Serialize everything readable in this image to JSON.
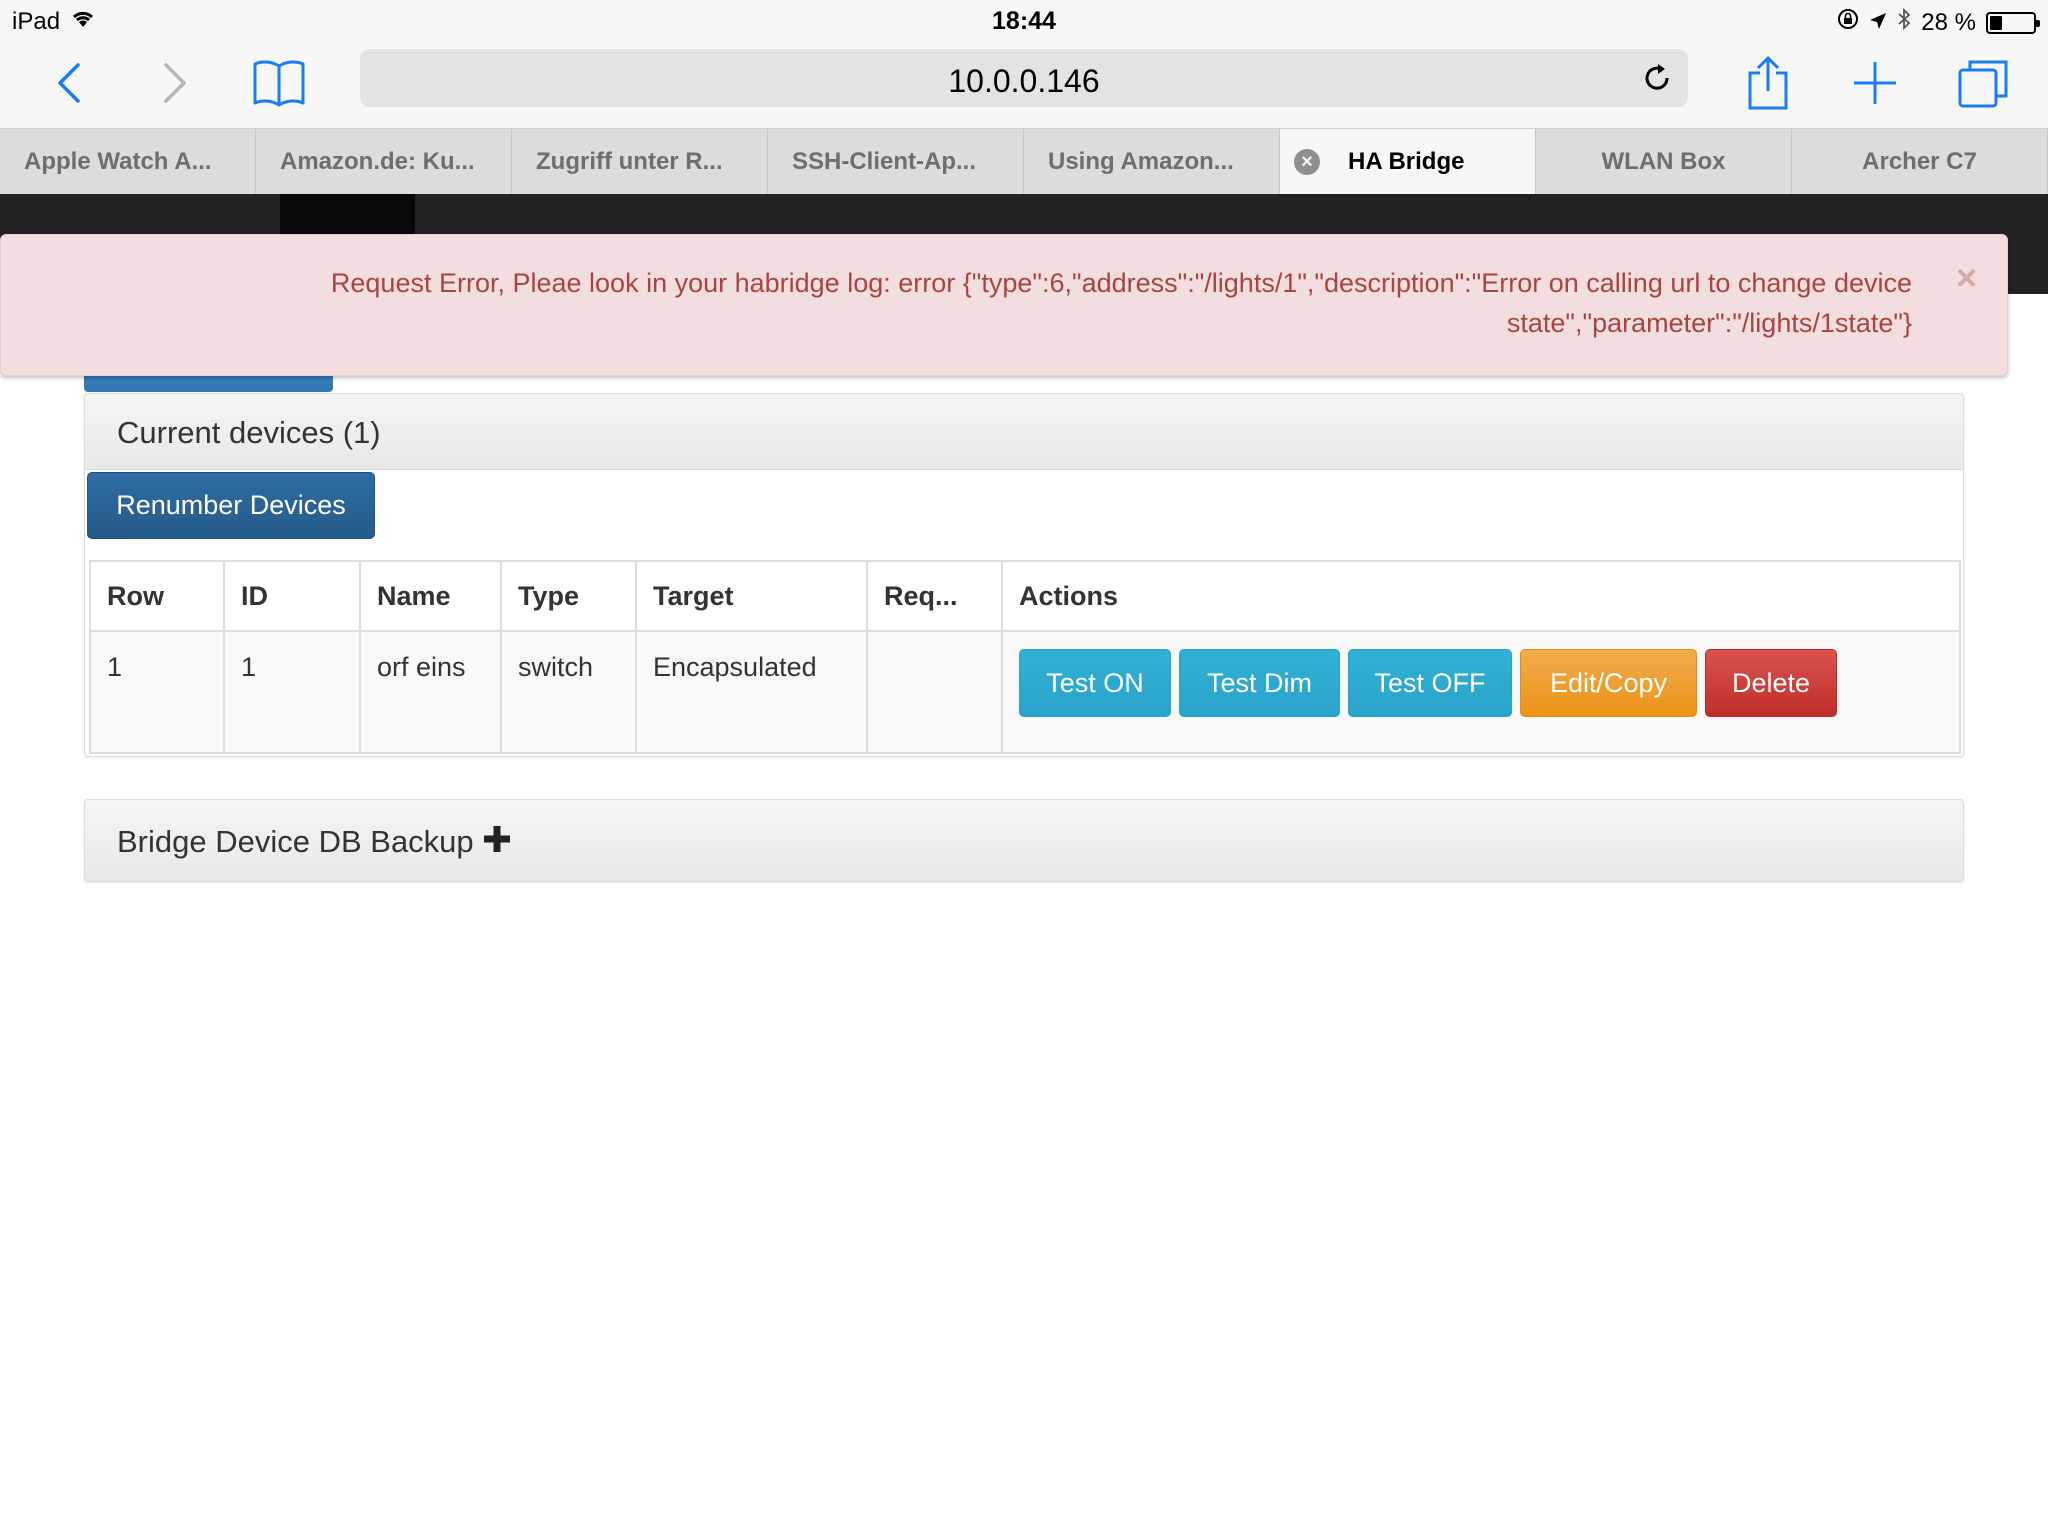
{
  "status_bar": {
    "device": "iPad",
    "time": "18:44",
    "battery": "28 %",
    "battery_level": 0.28,
    "icons": [
      "wifi-icon",
      "rotation-lock-icon",
      "location-icon",
      "bluetooth-icon",
      "battery-icon"
    ]
  },
  "browser": {
    "url": "10.0.0.146",
    "toolbar_icons": [
      "back-icon",
      "forward-icon",
      "bookmarks-icon",
      "reload-icon",
      "share-icon",
      "new-tab-icon",
      "tabs-icon"
    ],
    "accent_color": "#1a7cf5"
  },
  "tabs": [
    {
      "label": "Apple Watch A..."
    },
    {
      "label": "Amazon.de: Ku..."
    },
    {
      "label": "Zugriff unter R..."
    },
    {
      "label": "SSH-Client-Ap..."
    },
    {
      "label": "Using Amazon..."
    },
    {
      "label": "HA Bridge",
      "active": true
    },
    {
      "label": "WLAN Box"
    },
    {
      "label": "Archer C7"
    }
  ],
  "alert": {
    "message": "Request Error, Pleae look in your habridge log: error {\"type\":6,\"address\":\"/lights/1\",\"description\":\"Error on calling url to change device state\",\"parameter\":\"/lights/1state\"}",
    "close": "×",
    "color": "#a94442"
  },
  "devices_panel": {
    "title": "Current devices (1)",
    "renumber_label": "Renumber Devices",
    "columns": [
      "Row",
      "ID",
      "Name",
      "Type",
      "Target",
      "Req...",
      "Actions"
    ],
    "rows": [
      {
        "row": "1",
        "id": "1",
        "name": "orf eins",
        "type": "switch",
        "target": "Encapsulated",
        "req": ""
      }
    ],
    "actions": {
      "test_on": "Test ON",
      "test_dim": "Test Dim",
      "test_off": "Test OFF",
      "edit_copy": "Edit/Copy",
      "delete": "Delete"
    }
  },
  "backup_panel": {
    "title": "Bridge Device DB Backup",
    "icon": "plus-icon"
  }
}
